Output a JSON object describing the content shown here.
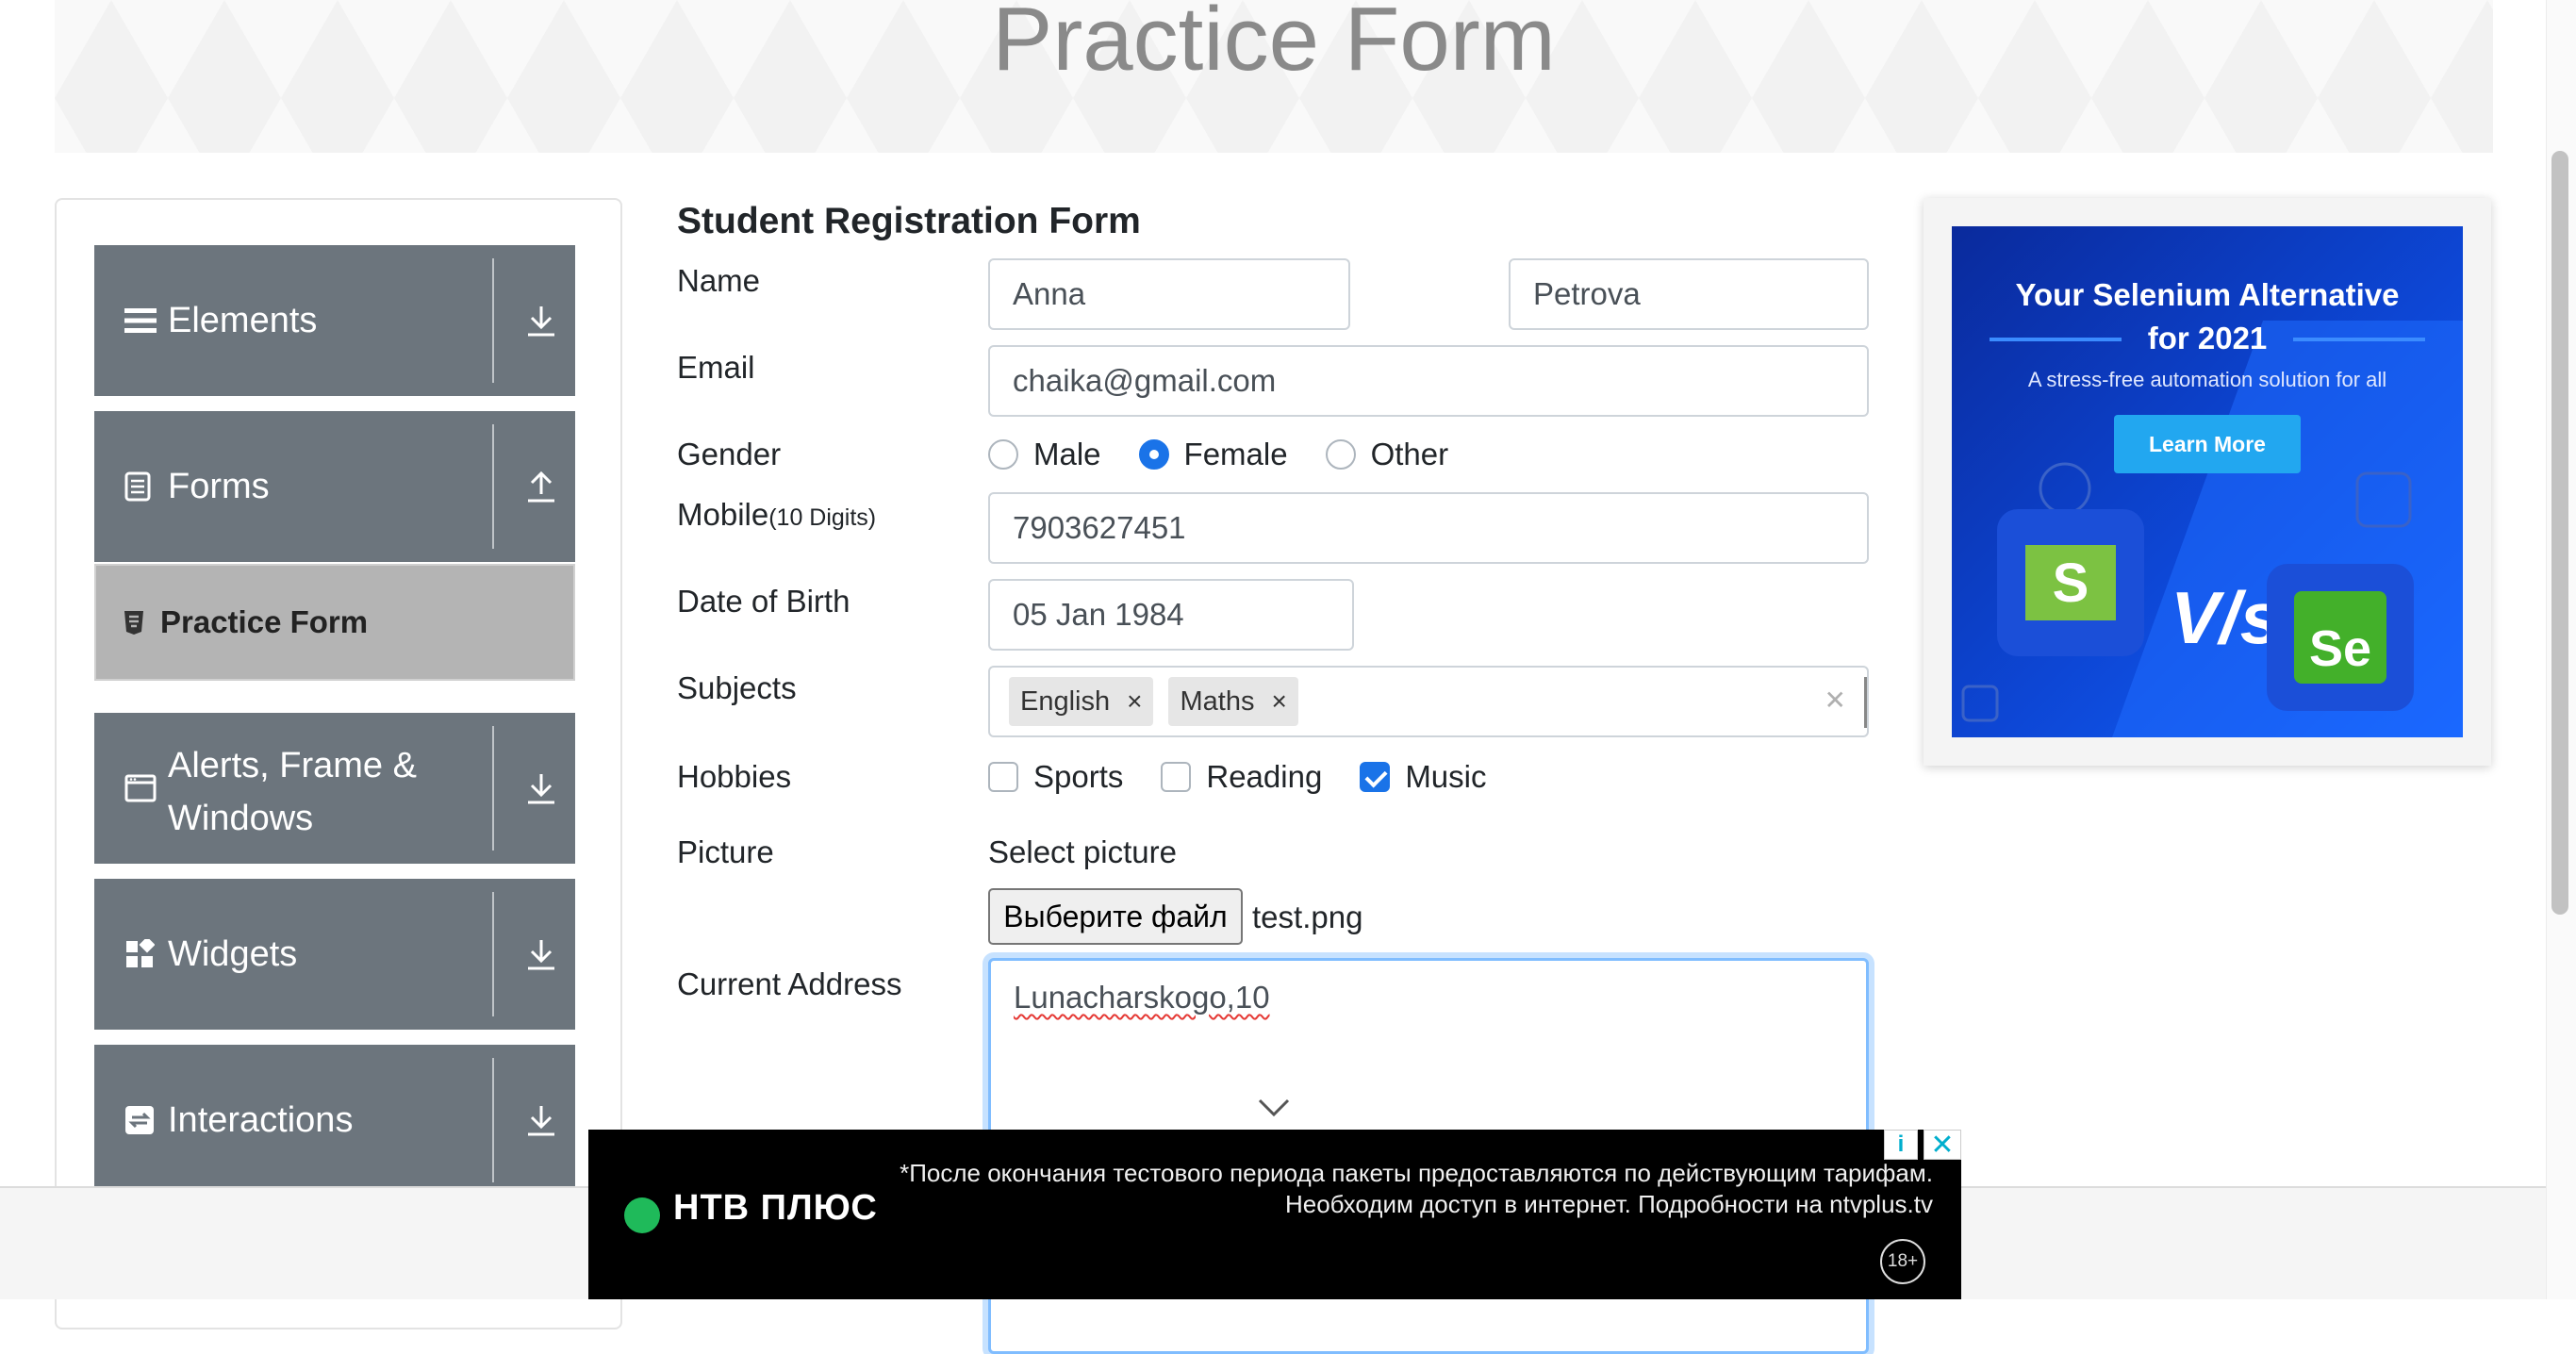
{
  "header": {
    "title": "Practice Form"
  },
  "sidebar": {
    "groups": [
      {
        "label": "Elements",
        "state": "collapsed"
      },
      {
        "label": "Forms",
        "state": "expanded"
      },
      {
        "label_line1": "Alerts, Frame &",
        "label_line2": "Windows",
        "state": "collapsed"
      },
      {
        "label": "Widgets",
        "state": "collapsed"
      },
      {
        "label": "Interactions",
        "state": "collapsed"
      }
    ],
    "active_item": "Practice Form"
  },
  "form": {
    "title": "Student Registration Form",
    "name": {
      "label": "Name",
      "first": "Anna",
      "last": "Petrova"
    },
    "email": {
      "label": "Email",
      "value": "chaika@gmail.com"
    },
    "gender": {
      "label": "Gender",
      "options": [
        "Male",
        "Female",
        "Other"
      ],
      "selected": "Female"
    },
    "mobile": {
      "label": "Mobile",
      "hint": "(10 Digits)",
      "value": "7903627451"
    },
    "dob": {
      "label": "Date of Birth",
      "value": "05 Jan 1984"
    },
    "subjects": {
      "label": "Subjects",
      "chips": [
        "English",
        "Maths"
      ],
      "remove_glyph": "×",
      "clear_glyph": "✕"
    },
    "hobbies": {
      "label": "Hobbies",
      "options": [
        "Sports",
        "Reading",
        "Music"
      ],
      "checked": [
        "Music"
      ]
    },
    "picture": {
      "label": "Picture",
      "prompt": "Select picture",
      "button": "Выберите файл",
      "filename": "test.png"
    },
    "address": {
      "label": "Current Address",
      "value": "Lunacharskogo,10"
    }
  },
  "ad_right": {
    "title_line1": "Your Selenium Alternative",
    "title_line2": "for 2021",
    "subtitle": "A stress-free automation solution for all",
    "button": "Learn More",
    "vs": "V/s",
    "logo_left": "S",
    "logo_right": "Se"
  },
  "ad_bottom": {
    "brand": "НТВ ПЛЮС",
    "disclaimer_line1": "*После окончания тестового периода пакеты предоставляются по действующим тарифам.",
    "disclaimer_line2": "Необходим доступ в интернет. Подробности на ntvplus.tv",
    "age": "18+",
    "info_glyph": "i",
    "close_glyph": "✕"
  },
  "colors": {
    "sidebar_bg": "#6c757d",
    "active_item_bg": "#b4b4b4",
    "accent": "#1a73e8",
    "focus_border": "#80bdff",
    "ad_blue": "#0d47d6",
    "ad_button": "#22a7f0"
  },
  "icons": {
    "elements": "hamburger-icon",
    "forms": "document-icon",
    "practice_form": "html5-icon",
    "alerts": "window-icon",
    "widgets": "widgets-icon",
    "interactions": "swap-icon",
    "collapsed_arrow": "download-arrow-icon",
    "expanded_arrow": "upload-arrow-icon"
  }
}
